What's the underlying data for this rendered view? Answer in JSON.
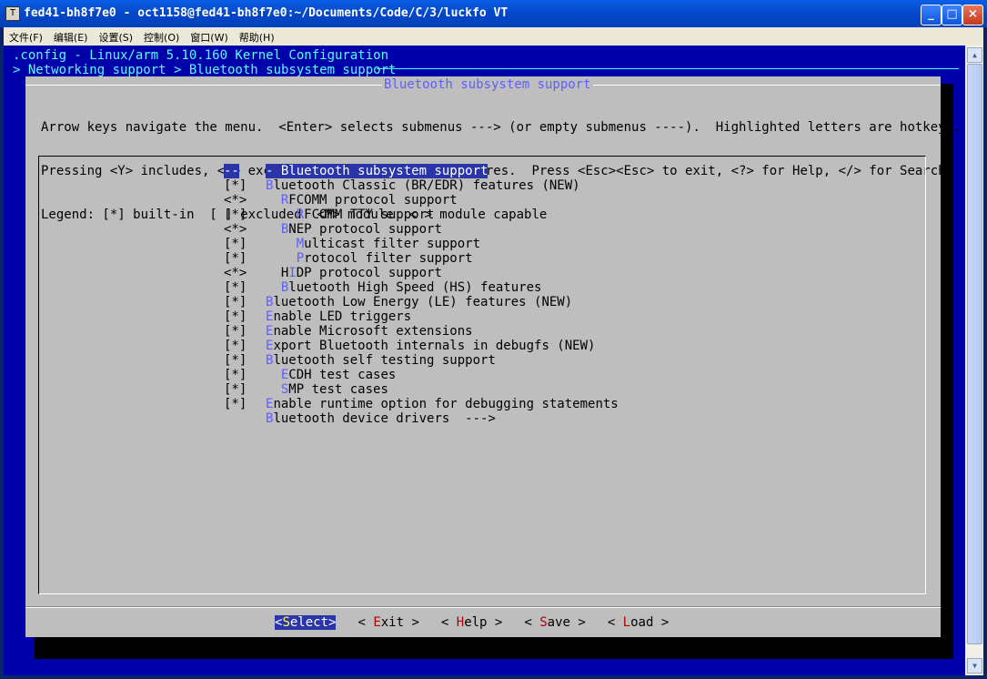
{
  "window": {
    "title": "fed41-bh8f7e0 - oct1158@fed41-bh8f7e0:~/Documents/Code/C/3/luckfo VT",
    "controls": [
      "_",
      "□",
      "×"
    ]
  },
  "menubar": [
    "文件(F)",
    "编辑(E)",
    "设置(S)",
    "控制(O)",
    "窗口(W)",
    "帮助(H)"
  ],
  "terminal": {
    "header": ".config - Linux/arm 5.10.160 Kernel Configuration",
    "breadcrumb": "> Networking support > Bluetooth subsystem support",
    "dialog_title": "Bluetooth subsystem support",
    "help_lines": [
      "Arrow keys navigate the menu.  <Enter> selects submenus ---> (or empty submenus ----).  Highlighted letters are hotkeys.",
      "Pressing <Y> includes, <N> excludes, <M> modularizes features.  Press <Esc><Esc> to exit, <?> for Help, </> for Search.",
      "Legend: [*] built-in  [ ] excluded  <M> module  < > module capable"
    ],
    "menu": [
      {
        "mark": "--",
        "hot": "",
        "rest": "- Bluetooth subsystem support",
        "indent": 0,
        "selected": true
      },
      {
        "mark": "[*]",
        "hot": "B",
        "rest": "luetooth Classic (BR/EDR) features (NEW)",
        "indent": 0
      },
      {
        "mark": "<*>",
        "hot": "R",
        "rest": "FCOMM protocol support",
        "indent": 2
      },
      {
        "mark": "[*]",
        "hot": "R",
        "rest": "FCOMM TTY support",
        "indent": 4
      },
      {
        "mark": "<*>",
        "hot": "B",
        "rest": "NEP protocol support",
        "indent": 2
      },
      {
        "mark": "[*]",
        "hot": "M",
        "rest": "ulticast filter support",
        "indent": 4
      },
      {
        "mark": "[*]",
        "hot": "P",
        "rest": "rotocol filter support",
        "indent": 4
      },
      {
        "mark": "<*>",
        "hot": "H",
        "rest": "IDP protocol support",
        "indent": 2,
        "hot_pos": 1
      },
      {
        "mark": "[*]",
        "hot": "B",
        "rest": "luetooth High Speed (HS) features",
        "indent": 2
      },
      {
        "mark": "[*]",
        "hot": "B",
        "rest": "luetooth Low Energy (LE) features (NEW)",
        "indent": 0
      },
      {
        "mark": "[*]",
        "hot": "E",
        "rest": "nable LED triggers",
        "indent": 0
      },
      {
        "mark": "[*]",
        "hot": "E",
        "rest": "nable Microsoft extensions",
        "indent": 0
      },
      {
        "mark": "[*]",
        "hot": "E",
        "rest": "xport Bluetooth internals in debugfs (NEW)",
        "indent": 0
      },
      {
        "mark": "[*]",
        "hot": "B",
        "rest": "luetooth self testing support",
        "indent": 0
      },
      {
        "mark": "[*]",
        "hot": "E",
        "rest": "CDH test cases",
        "indent": 2
      },
      {
        "mark": "[*]",
        "hot": "S",
        "rest": "MP test cases",
        "indent": 2
      },
      {
        "mark": "[*]",
        "hot": "E",
        "rest": "nable runtime option for debugging statements",
        "indent": 0
      },
      {
        "mark": "",
        "hot": "B",
        "rest": "luetooth device drivers  --->",
        "indent": 0
      }
    ],
    "buttons": [
      {
        "pre": "<",
        "hot": "S",
        "rest": "elect>",
        "active": true
      },
      {
        "pre": "< ",
        "hot": "E",
        "rest": "xit >",
        "active": false
      },
      {
        "pre": "< ",
        "hot": "H",
        "rest": "elp >",
        "active": false
      },
      {
        "pre": "< ",
        "hot": "S",
        "rest": "ave >",
        "active": false
      },
      {
        "pre": "< ",
        "hot": "L",
        "rest": "oad >",
        "active": false
      }
    ]
  },
  "icons": {
    "app": "terminal-app-icon"
  }
}
